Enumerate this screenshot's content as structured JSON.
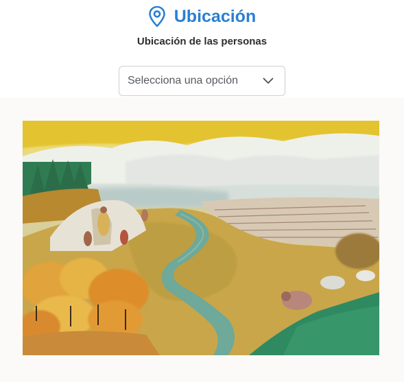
{
  "header": {
    "title": "Ubicación",
    "icon": "map-pin-icon",
    "accent_color": "#2a7fd4"
  },
  "subtitle": "Ubicación de las personas",
  "select": {
    "value": "Selecciona una opción",
    "icon": "chevron-down-icon"
  },
  "illustration": {
    "kind": "watercolor landscape painting"
  }
}
